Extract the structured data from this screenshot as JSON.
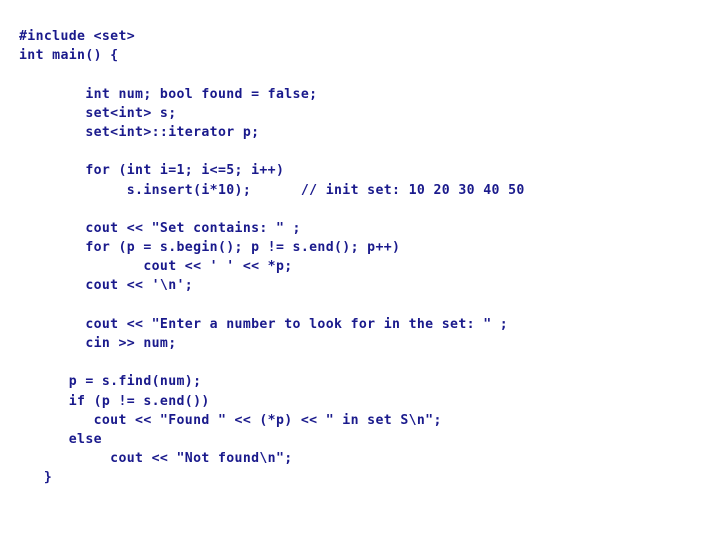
{
  "slide": {
    "background_color": "#ffffff",
    "text_color": "#1a1a8c",
    "language": "C++",
    "lines": [
      "#include <set>",
      "int main() {",
      "",
      "        int num; bool found = false;",
      "        set<int> s;",
      "        set<int>::iterator p;",
      "",
      "        for (int i=1; i<=5; i++)",
      "             s.insert(i*10);      // init set: 10 20 30 40 50",
      "",
      "        cout << \"Set contains: \" ;",
      "        for (p = s.begin(); p != s.end(); p++)",
      "               cout << ' ' << *p;",
      "        cout << '\\n';",
      "",
      "        cout << \"Enter a number to look for in the set: \" ;",
      "        cin >> num;",
      "",
      "      p = s.find(num);",
      "      if (p != s.end())",
      "         cout << \"Found \" << (*p) << \" in set S\\n\";",
      "      else",
      "           cout << \"Not found\\n\";",
      "   }"
    ]
  }
}
